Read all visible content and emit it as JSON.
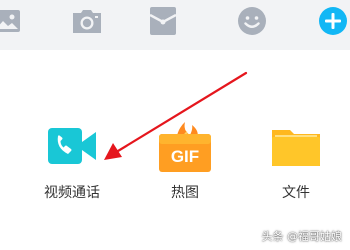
{
  "colors": {
    "toolbar_bg": "#f2f3f5",
    "toolbar_icon": "#a9b0bb",
    "plus_button": "#12b7f5",
    "arrow": "#e5161d",
    "video_icon": "#19c7d6",
    "folder_icon": "#ffc629"
  },
  "toolbar": {
    "icons": [
      "image-icon",
      "camera-icon",
      "red-envelope-icon",
      "emoji-icon",
      "plus-icon"
    ]
  },
  "tiles": [
    {
      "label": "视频通话",
      "icon": "video-call-icon"
    },
    {
      "label": "热图",
      "icon": "gif-icon",
      "icon_text": "GIF"
    },
    {
      "label": "文件",
      "icon": "folder-icon"
    }
  ],
  "watermark": "头条 @福哥姑娘"
}
